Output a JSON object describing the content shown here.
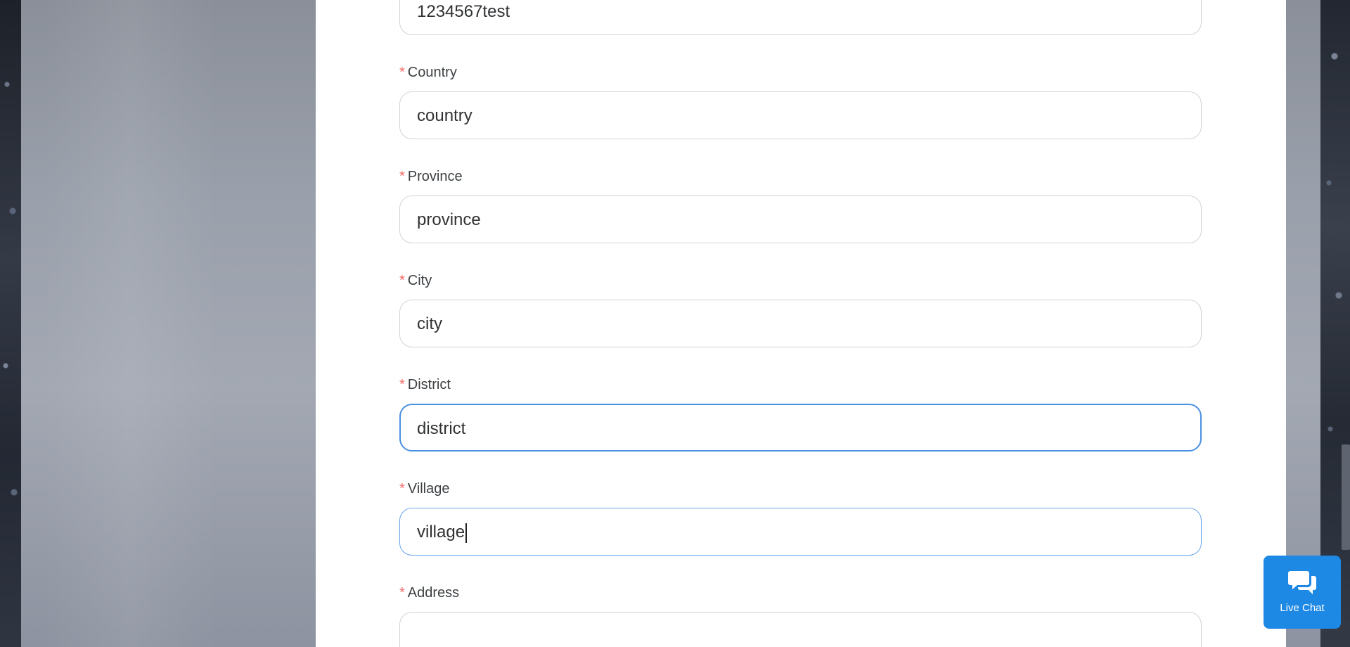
{
  "form": {
    "fields": [
      {
        "label": "",
        "required": false,
        "value": "1234567test"
      },
      {
        "label": "Country",
        "required": true,
        "value": "country"
      },
      {
        "label": "Province",
        "required": true,
        "value": "province"
      },
      {
        "label": "City",
        "required": true,
        "value": "city"
      },
      {
        "label": "District",
        "required": true,
        "value": "district"
      },
      {
        "label": "Village",
        "required": true,
        "value": "village"
      },
      {
        "label": "Address",
        "required": true,
        "value": ""
      }
    ],
    "required_mark": "*"
  },
  "live_chat": {
    "label": "Live Chat",
    "icon": "chat-bubbles-icon"
  },
  "colors": {
    "required_mark": "#f56c6c",
    "focus_border": "#4a90e2",
    "live_chat_bg": "#1e88e5"
  }
}
